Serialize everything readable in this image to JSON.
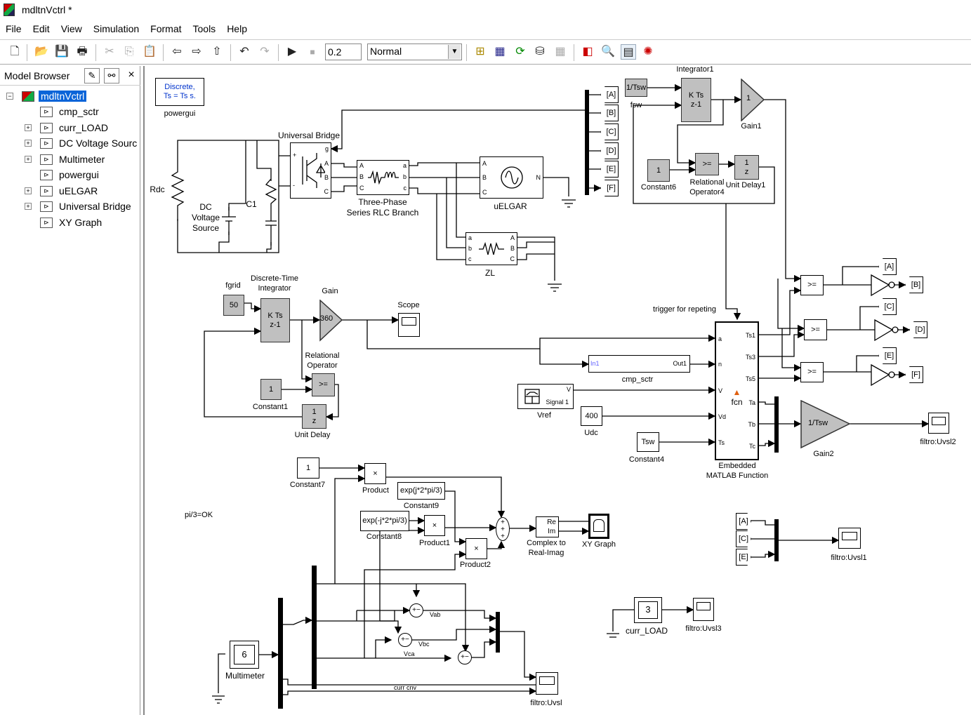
{
  "window": {
    "title": "mdltnVctrl *",
    "icon": "simulink-model-icon"
  },
  "menu": [
    "File",
    "Edit",
    "View",
    "Simulation",
    "Format",
    "Tools",
    "Help"
  ],
  "toolbar": {
    "sim_stop_time": "0.2",
    "sim_mode": "Normal",
    "icons": [
      "new-icon",
      "open-icon",
      "save-icon",
      "print-icon",
      "cut-icon",
      "copy-icon",
      "paste-icon",
      "back-icon",
      "forward-icon",
      "up-icon",
      "undo-icon",
      "redo-icon",
      "run-icon",
      "stop-icon",
      "library-browser-icon",
      "model-explorer-icon",
      "update-icon",
      "build-icon",
      "debug-icon",
      "subsystem-icon",
      "model-advisor-icon",
      "browser-icon",
      "debugger-icon"
    ]
  },
  "browser": {
    "title": "Model Browser",
    "close": "×",
    "items": [
      {
        "label": "mdltnVctrl",
        "expand": "−",
        "selected": true
      },
      {
        "label": "cmp_sctr"
      },
      {
        "label": "curr_LOAD",
        "expand": "+"
      },
      {
        "label": "DC Voltage Sourc",
        "expand": "+"
      },
      {
        "label": "Multimeter",
        "expand": "+"
      },
      {
        "label": "powergui"
      },
      {
        "label": "uELGAR",
        "expand": "+"
      },
      {
        "label": "Universal Bridge",
        "expand": "+"
      },
      {
        "label": "XY Graph"
      }
    ]
  },
  "diagram": {
    "powergui": {
      "text": "Discrete,\nTs = Ts s.",
      "label": "powergui"
    },
    "universal_bridge": {
      "label": "Universal Bridge",
      "ports": [
        "+",
        "-",
        "g",
        "A",
        "B",
        "C"
      ]
    },
    "rlc": {
      "label": "Three-Phase\nSeries RLC Branch",
      "ports": [
        "A",
        "B",
        "C",
        "a",
        "b",
        "c"
      ]
    },
    "uelgar": {
      "label": "uELGAR",
      "ports": [
        "A",
        "B",
        "C",
        "N"
      ]
    },
    "zl": {
      "label": "ZL",
      "ports": [
        "a",
        "b",
        "c",
        "A",
        "B",
        "C"
      ]
    },
    "rdc": {
      "label": "Rdc"
    },
    "dc_source": {
      "label": "DC\nVoltage\nSource"
    },
    "c1": {
      "label": "C1"
    },
    "gotos_top": [
      "[A]",
      "[B]",
      "[C]",
      "[D]",
      "[E]",
      "[F]"
    ],
    "fsw": {
      "text": "1/Tsw",
      "label": "fsw"
    },
    "integrator1": {
      "text": "K Ts\nz-1",
      "label": "Integrator1"
    },
    "gain1": {
      "text": "1",
      "label": "Gain1"
    },
    "constant6": {
      "text": "1",
      "label": "Constant6"
    },
    "relop4": {
      "text": ">=",
      "label": "Relational\nOperator4"
    },
    "unit_delay1": {
      "text": "1\nz",
      "label": "Unit Delay1"
    },
    "trigger_note": "trigger for repeting",
    "emf": {
      "label": "Embedded\nMATLAB Function",
      "center": "fcn",
      "inputs": [
        "a",
        "n",
        "V",
        "Vd",
        "Ts"
      ],
      "outputs": [
        "Ts1",
        "Ts3",
        "Ts5",
        "Ta",
        "Tb",
        "Tc"
      ]
    },
    "relops": [
      ">=",
      ">=",
      ">="
    ],
    "gotos_right": [
      "[A]",
      "[B]",
      "[C]",
      "[D]",
      "[E]",
      "[F]"
    ],
    "gain2": {
      "text": "1/Tsw",
      "label": "Gain2"
    },
    "scope_uvsl2": {
      "label": "filtro:Uvsl2"
    },
    "fgrid": {
      "text": "50",
      "label": "fgrid"
    },
    "dt_integrator": {
      "text": "K Ts\nz-1",
      "label": "Discrete-Time\nIntegrator"
    },
    "gain": {
      "text": "360",
      "label": "Gain"
    },
    "scope": {
      "label": "Scope"
    },
    "relop": {
      "text": ">=",
      "label": "Relational\nOperator"
    },
    "constant1": {
      "text": "1",
      "label": "Constant1"
    },
    "unit_delay": {
      "text": "1\nz",
      "label": "Unit Delay"
    },
    "cmp_sctr": {
      "label": "cmp_sctr",
      "in": "In1",
      "out": "Out1"
    },
    "vref": {
      "label": "Vref",
      "port": "V",
      "signal": "Signal 1"
    },
    "udc": {
      "text": "400",
      "label": "Udc"
    },
    "constant4": {
      "text": "Tsw",
      "label": "Constant4"
    },
    "constant7": {
      "text": "1",
      "label": "Constant7"
    },
    "product": {
      "text": "×",
      "label": "Product"
    },
    "constant9": {
      "text": "exp(j*2*pi/3)",
      "label": "Constant9"
    },
    "constant8": {
      "text": "exp(-j*2*pi/3)",
      "label": "Constant8"
    },
    "product1": {
      "text": "×",
      "label": "Product1"
    },
    "product2": {
      "text": "×",
      "label": "Product2"
    },
    "c2ri": {
      "re": "Re",
      "im": "Im",
      "label": "Complex to\nReal-Imag"
    },
    "xy_graph": {
      "label": "XY Graph"
    },
    "note_pi": "pi/3=OK",
    "vab": "Vab",
    "vbc": "Vbc",
    "vca": "Vca",
    "multimeter": {
      "text": "6",
      "label": "Multimeter"
    },
    "scope_uvsl": {
      "label": "filtro:Uvsl"
    },
    "curr_cnv": "curr cnv",
    "froms": [
      "[A]",
      "[C]",
      "[E]"
    ],
    "scope_uvsl1": {
      "label": "filtro:Uvsl1"
    },
    "curr_load": {
      "text": "3",
      "label": "curr_LOAD"
    },
    "scope_uvsl3": {
      "label": "filtro:Uvsl3"
    }
  }
}
